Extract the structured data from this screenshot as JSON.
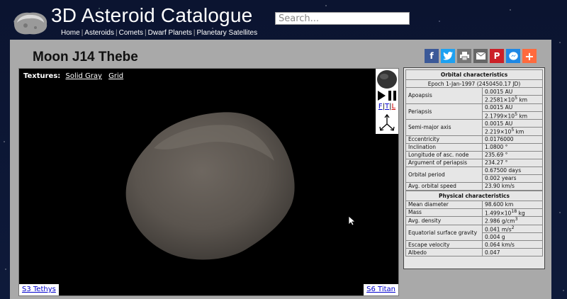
{
  "site": {
    "title": "3D Asteroid Catalogue",
    "search_placeholder": "Search...",
    "nav": [
      "Home",
      "Asteroids",
      "Comets",
      "Dwarf Planets",
      "Planetary Satellites"
    ]
  },
  "page": {
    "title": "Moon J14 Thebe"
  },
  "share_icons": [
    "facebook-icon",
    "twitter-icon",
    "print-icon",
    "email-icon",
    "pinterest-icon",
    "messenger-icon",
    "more-icon"
  ],
  "viewer": {
    "textures_label": "Textures:",
    "textures": [
      "Solid Gray",
      "Grid"
    ],
    "controls": {
      "view_labels": [
        "F",
        "T",
        "L"
      ]
    },
    "prev_link": "S3 Tethys",
    "next_link": "S6 Titan"
  },
  "orbital": {
    "heading": "Orbital characteristics",
    "epoch": "Epoch 1-Jan-1997 (2450450.17 JD)",
    "rows": [
      {
        "label": "Apoapsis",
        "values": [
          "0.0015 AU",
          "2.2581×10<sup>5</sup> km"
        ]
      },
      {
        "label": "Periapsis",
        "values": [
          "0.0015 AU",
          "2.1799×10<sup>5</sup> km"
        ]
      },
      {
        "label": "Semi-major axis",
        "values": [
          "0.0015 AU",
          "2.219×10<sup>5</sup> km"
        ]
      },
      {
        "label": "Eccentricity",
        "values": [
          "0.0176000"
        ]
      },
      {
        "label": "Inclination",
        "values": [
          "1.0800 °"
        ]
      },
      {
        "label": "Longitude of asc. node",
        "values": [
          "235.69 °"
        ]
      },
      {
        "label": "Argument of periapsis",
        "values": [
          "234.27 °"
        ]
      },
      {
        "label": "Orbital period",
        "values": [
          "0.67500 days",
          "0.002 years"
        ]
      },
      {
        "label": "Avg. orbital speed",
        "values": [
          "23.90 km/s"
        ]
      }
    ]
  },
  "physical": {
    "heading": "Physical characteristics",
    "rows": [
      {
        "label": "Mean diameter",
        "values": [
          "98.600 km"
        ]
      },
      {
        "label": "Mass",
        "values": [
          "1.499×10<sup>18</sup> kg"
        ]
      },
      {
        "label": "Avg. density",
        "values": [
          "2.986 g/cm<sup>3</sup>"
        ]
      },
      {
        "label": "Equatorial surface gravity",
        "values": [
          "0.041 m/s<sup>2</sup>",
          "0.004 g"
        ]
      },
      {
        "label": "Escape velocity",
        "values": [
          "0.064 km/s"
        ]
      },
      {
        "label": "Albedo",
        "values": [
          "0.047"
        ]
      }
    ]
  },
  "colors": {
    "panel": "#a9a9a9",
    "facebook": "#3b5998",
    "twitter": "#1da1f2",
    "print": "#777777",
    "email": "#666666",
    "pinterest": "#cb2027",
    "messenger": "#1e88e5",
    "more": "#ff6a3d"
  }
}
